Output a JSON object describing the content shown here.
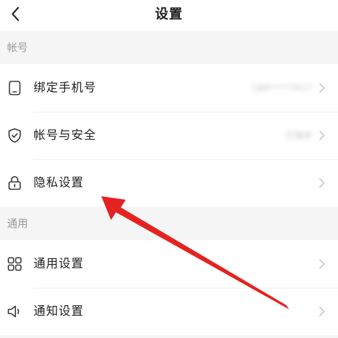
{
  "header": {
    "title": "设置",
    "back_icon": "chevron-left-icon"
  },
  "sections": [
    {
      "label": "帐号",
      "items": [
        {
          "label": "绑定手机号",
          "value": "188****7917",
          "icon": "phone-icon",
          "has_chevron": true
        },
        {
          "label": "帐号与安全",
          "value": "已保护",
          "icon": "shield-check-icon",
          "has_chevron": true
        },
        {
          "label": "隐私设置",
          "icon": "lock-icon",
          "has_chevron": true
        }
      ]
    },
    {
      "label": "通用",
      "items": [
        {
          "label": "通用设置",
          "icon": "grid-icon",
          "has_chevron": true
        },
        {
          "label": "通知设置",
          "icon": "speaker-icon",
          "has_chevron": true
        }
      ]
    }
  ],
  "colors": {
    "background": "#f5f5f5",
    "card": "#ffffff",
    "text": "#1f1f1f",
    "section_label": "#9a9a9a",
    "annotation_arrow": "#e52222"
  }
}
